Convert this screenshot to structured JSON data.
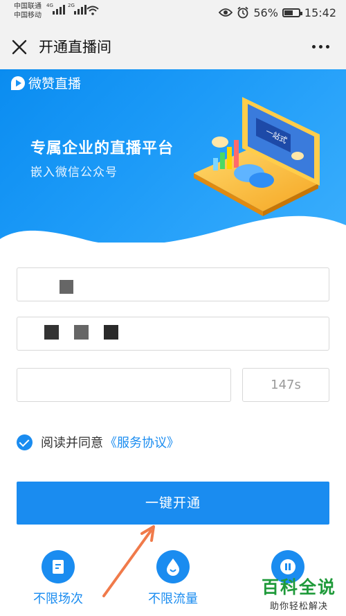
{
  "status_bar": {
    "carrier_1": "中国联通",
    "carrier_2": "中国移动",
    "net_1": "4G",
    "net_2": "2G",
    "battery": "56%",
    "time": "15:42"
  },
  "titlebar": {
    "title": "开通直播间",
    "close_icon": "close-icon",
    "more_icon": "more-icon"
  },
  "banner": {
    "brand": "微赞直播",
    "headline": "专属企业的直播平台",
    "subline": "嵌入微信公众号",
    "screen_text": "一站式"
  },
  "form": {
    "name_value": "",
    "phone_value": "",
    "code_value": "",
    "countdown": "147s"
  },
  "agreement": {
    "text": "阅读并同意",
    "link": "《服务协议》"
  },
  "submit_label": "一键开通",
  "features": [
    {
      "label": "不限场次",
      "icon": "document-icon"
    },
    {
      "label": "不限流量",
      "icon": "drop-icon"
    },
    {
      "label": "",
      "icon": "pause-icon"
    }
  ],
  "watermark": {
    "title": "百科全说",
    "subtitle": "助你轻松解决"
  },
  "colors": {
    "primary": "#1a8cf0",
    "banner_start": "#0a8cf0",
    "watermark_green": "#1f9a3a",
    "arrow": "#f07a4a"
  }
}
